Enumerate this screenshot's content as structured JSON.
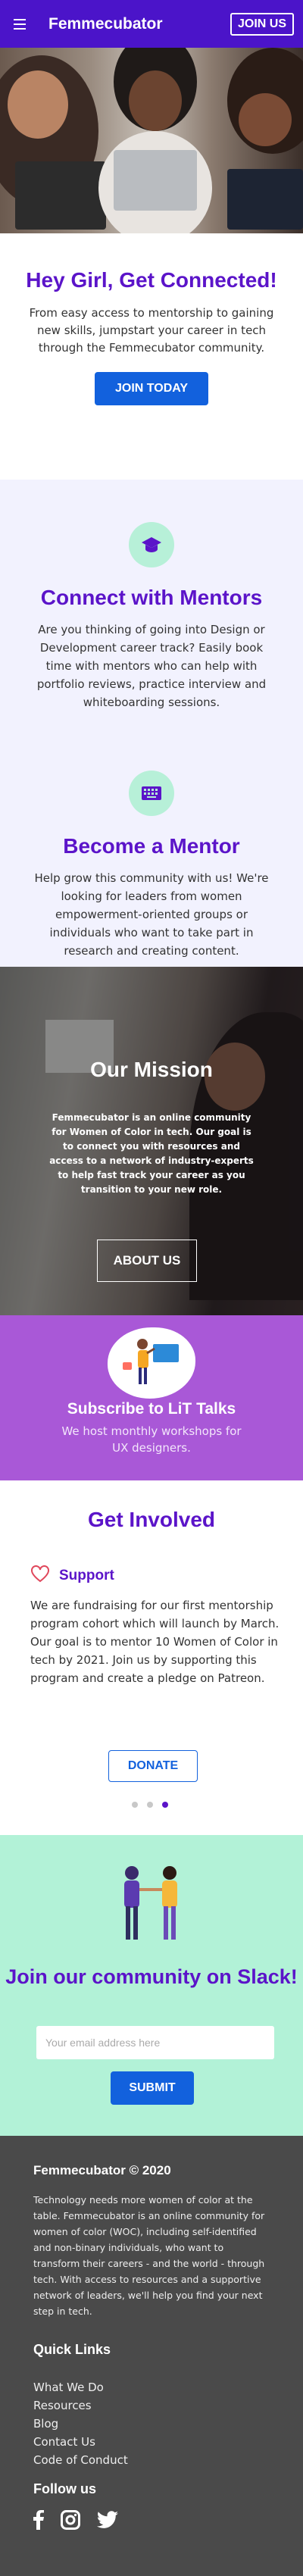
{
  "header": {
    "brand": "Femmecubator",
    "join_label": "JOIN US"
  },
  "intro": {
    "title": "Hey Girl, Get Connected!",
    "text": "From easy access to mentorship to gaining new skills, jumpstart your career in tech through the Femmecubator community.",
    "button_label": "JOIN TODAY"
  },
  "mentors": {
    "icon": "graduation-cap-icon",
    "title": "Connect with Mentors",
    "text": "Are you thinking of going into Design or Development career track? Easily book time with mentors who can help with portfolio reviews, practice interview and whiteboarding sessions."
  },
  "become": {
    "icon": "keyboard-icon",
    "title": "Become a Mentor",
    "text": "Help grow this community with us! We're looking for leaders from women empowerment-oriented groups or individuals who want to take part in research and creating content."
  },
  "mission": {
    "title": "Our Mission",
    "text": "Femmecubator is an online community for Women of Color in tech. Our goal is to connect you with resources and access to a network of industry-experts to help fast track your career as you transition to your new role.",
    "button_label": "ABOUT US"
  },
  "lit": {
    "title": "Subscribe to LiT Talks",
    "text": "We host monthly workshops for UX designers."
  },
  "involved": {
    "title": "Get Involved",
    "support_label": "Support",
    "text": "We are fundraising for our first mentorship program cohort which will launch by March. Our goal is to mentor 10 Women of Color in tech by 2021. Join us by supporting this program and create a pledge on Patreon.",
    "button_label": "DONATE",
    "carousel_active_index": 2,
    "carousel_count": 3
  },
  "slack": {
    "title": "Join our community on Slack!",
    "email_placeholder": "Your email address here",
    "button_label": "SUBMIT"
  },
  "footer": {
    "copyright": "Femmecubator © 2020",
    "about": "Technology needs more women of color at the table. Femmecubator is an online community for women of color (WOC), including self-identified and non-binary individuals, who want to transform their careers - and the world - through tech. With access to resources and a supportive network of leaders, we'll help you find your next step in tech.",
    "quick_links_title": "Quick Links",
    "links": [
      "What We Do",
      "Resources",
      "Blog",
      "Contact Us",
      "Code of Conduct"
    ],
    "follow_title": "Follow us",
    "social": [
      "facebook-icon",
      "instagram-icon",
      "twitter-icon"
    ]
  },
  "colors": {
    "brand_purple": "#4b14c9",
    "heading_purple": "#5b14c9",
    "button_blue": "#1261dd",
    "mint": "#b2f2d7",
    "lilac_bg": "#f2f2fe",
    "lit_purple": "#a958d7",
    "footer_gray": "#4a4a4a"
  }
}
